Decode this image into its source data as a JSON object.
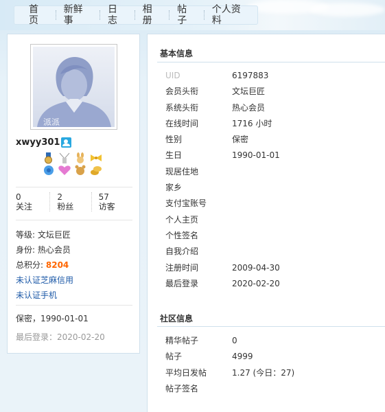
{
  "nav": {
    "items": [
      "首页",
      "新鲜事",
      "日志",
      "相册",
      "帖子",
      "个人资料"
    ]
  },
  "profile": {
    "avatar_text": "派派",
    "username": "xwyy301",
    "stats": [
      {
        "value": "0",
        "label": "关注"
      },
      {
        "value": "2",
        "label": "粉丝"
      },
      {
        "value": "57",
        "label": "访客"
      }
    ],
    "level_label": "等级:",
    "level_value": "文坛巨匠",
    "identity_label": "身份:",
    "identity_value": "热心会员",
    "points_label": "总积分:",
    "points_value": "8204",
    "link_zhima": "未认证芝麻信用",
    "link_phone": "未认证手机",
    "gender_birth": "保密，1990-01-01",
    "last_login": "最后登录：2020-02-20"
  },
  "basic": {
    "title": "基本信息",
    "rows": [
      {
        "k": "UID",
        "v": "6197883"
      },
      {
        "k": "会员头衔",
        "v": "文坛巨匠"
      },
      {
        "k": "系统头衔",
        "v": "热心会员"
      },
      {
        "k": "在线时间",
        "v": "1716 小时"
      },
      {
        "k": "性别",
        "v": "保密"
      },
      {
        "k": "生日",
        "v": "1990-01-01"
      },
      {
        "k": "现居住地",
        "v": ""
      },
      {
        "k": "家乡",
        "v": ""
      },
      {
        "k": "支付宝账号",
        "v": ""
      },
      {
        "k": "个人主页",
        "v": ""
      },
      {
        "k": "个性签名",
        "v": ""
      },
      {
        "k": "自我介绍",
        "v": ""
      },
      {
        "k": "注册时间",
        "v": "2009-04-30"
      },
      {
        "k": "最后登录",
        "v": "2020-02-20"
      }
    ]
  },
  "community": {
    "title": "社区信息",
    "rows": [
      {
        "k": "精华帖子",
        "v": "0"
      },
      {
        "k": "帖子",
        "v": "4999"
      },
      {
        "k": "平均日发帖",
        "v": "1.27 (今日：27)"
      },
      {
        "k": "帖子签名",
        "v": ""
      }
    ]
  },
  "colors": {
    "accent_link": "#1e5aa8",
    "points": "#ff6600",
    "panel_border": "#cfe0ec"
  }
}
